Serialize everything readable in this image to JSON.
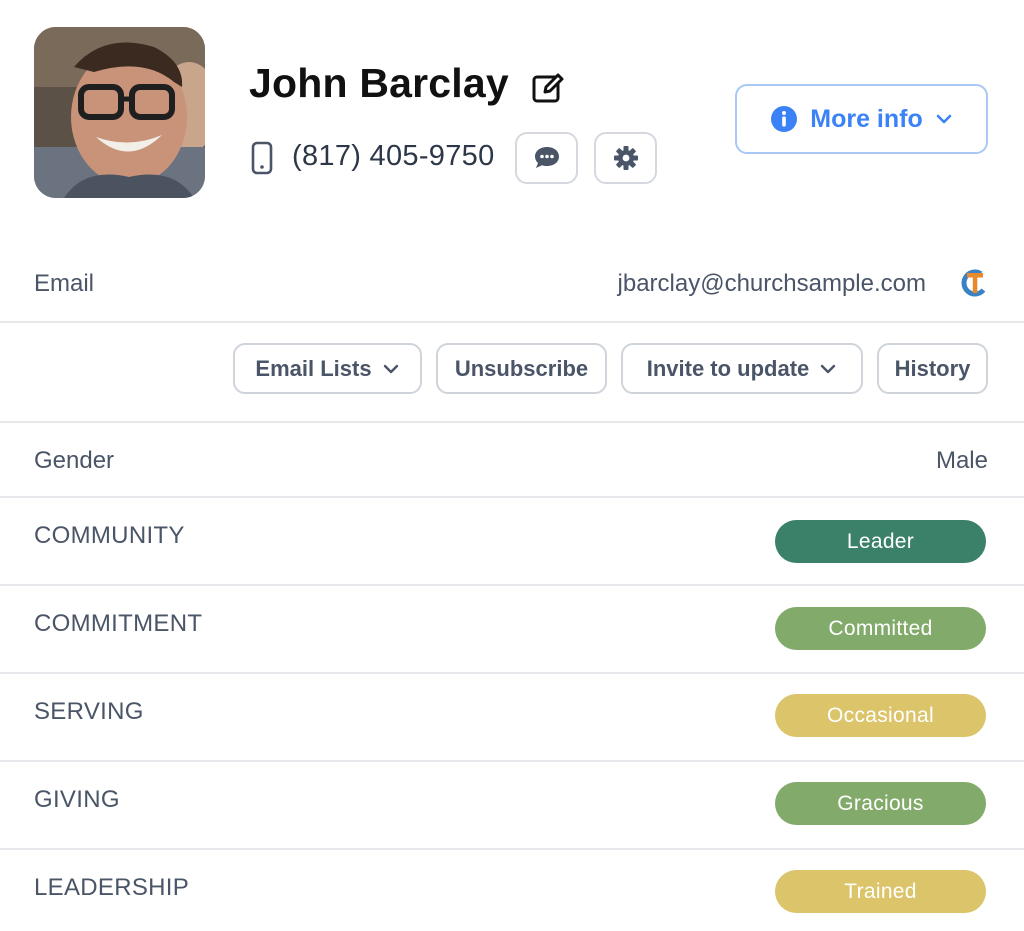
{
  "profile": {
    "name": "John Barclay",
    "phone": "(817) 405-9750",
    "more_info_label": "More info"
  },
  "email": {
    "label": "Email",
    "value": "jbarclay@churchsample.com"
  },
  "actions": {
    "email_lists": "Email Lists",
    "unsubscribe": "Unsubscribe",
    "invite_to_update": "Invite to update",
    "history": "History"
  },
  "gender": {
    "label": "Gender",
    "value": "Male"
  },
  "attributes": [
    {
      "label": "COMMUNITY",
      "badge": "Leader",
      "color": "#3b8068"
    },
    {
      "label": "COMMITMENT",
      "badge": "Committed",
      "color": "#82aa6a"
    },
    {
      "label": "SERVING",
      "badge": "Occasional",
      "color": "#dcc46a"
    },
    {
      "label": "GIVING",
      "badge": "Gracious",
      "color": "#82aa6a"
    },
    {
      "label": "LEADERSHIP",
      "badge": "Trained",
      "color": "#dcc46a"
    }
  ],
  "icons": {
    "edit": "edit-icon",
    "phone": "mobile-phone-icon",
    "message": "chat-bubble-icon",
    "settings": "gear-icon",
    "info": "info-icon",
    "chevron": "chevron-down-icon",
    "integration": "tc-logo-icon"
  }
}
